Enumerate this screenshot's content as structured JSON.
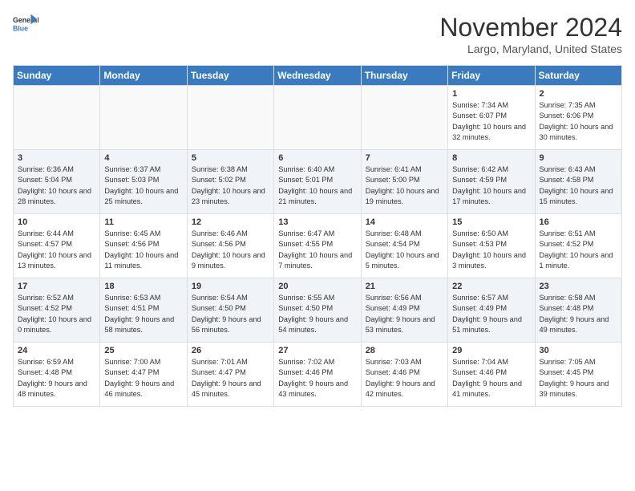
{
  "header": {
    "logo_line1": "General",
    "logo_line2": "Blue",
    "month": "November 2024",
    "location": "Largo, Maryland, United States"
  },
  "weekdays": [
    "Sunday",
    "Monday",
    "Tuesday",
    "Wednesday",
    "Thursday",
    "Friday",
    "Saturday"
  ],
  "weeks": [
    [
      {
        "day": "",
        "info": ""
      },
      {
        "day": "",
        "info": ""
      },
      {
        "day": "",
        "info": ""
      },
      {
        "day": "",
        "info": ""
      },
      {
        "day": "",
        "info": ""
      },
      {
        "day": "1",
        "info": "Sunrise: 7:34 AM\nSunset: 6:07 PM\nDaylight: 10 hours and 32 minutes."
      },
      {
        "day": "2",
        "info": "Sunrise: 7:35 AM\nSunset: 6:06 PM\nDaylight: 10 hours and 30 minutes."
      }
    ],
    [
      {
        "day": "3",
        "info": "Sunrise: 6:36 AM\nSunset: 5:04 PM\nDaylight: 10 hours and 28 minutes."
      },
      {
        "day": "4",
        "info": "Sunrise: 6:37 AM\nSunset: 5:03 PM\nDaylight: 10 hours and 25 minutes."
      },
      {
        "day": "5",
        "info": "Sunrise: 6:38 AM\nSunset: 5:02 PM\nDaylight: 10 hours and 23 minutes."
      },
      {
        "day": "6",
        "info": "Sunrise: 6:40 AM\nSunset: 5:01 PM\nDaylight: 10 hours and 21 minutes."
      },
      {
        "day": "7",
        "info": "Sunrise: 6:41 AM\nSunset: 5:00 PM\nDaylight: 10 hours and 19 minutes."
      },
      {
        "day": "8",
        "info": "Sunrise: 6:42 AM\nSunset: 4:59 PM\nDaylight: 10 hours and 17 minutes."
      },
      {
        "day": "9",
        "info": "Sunrise: 6:43 AM\nSunset: 4:58 PM\nDaylight: 10 hours and 15 minutes."
      }
    ],
    [
      {
        "day": "10",
        "info": "Sunrise: 6:44 AM\nSunset: 4:57 PM\nDaylight: 10 hours and 13 minutes."
      },
      {
        "day": "11",
        "info": "Sunrise: 6:45 AM\nSunset: 4:56 PM\nDaylight: 10 hours and 11 minutes."
      },
      {
        "day": "12",
        "info": "Sunrise: 6:46 AM\nSunset: 4:56 PM\nDaylight: 10 hours and 9 minutes."
      },
      {
        "day": "13",
        "info": "Sunrise: 6:47 AM\nSunset: 4:55 PM\nDaylight: 10 hours and 7 minutes."
      },
      {
        "day": "14",
        "info": "Sunrise: 6:48 AM\nSunset: 4:54 PM\nDaylight: 10 hours and 5 minutes."
      },
      {
        "day": "15",
        "info": "Sunrise: 6:50 AM\nSunset: 4:53 PM\nDaylight: 10 hours and 3 minutes."
      },
      {
        "day": "16",
        "info": "Sunrise: 6:51 AM\nSunset: 4:52 PM\nDaylight: 10 hours and 1 minute."
      }
    ],
    [
      {
        "day": "17",
        "info": "Sunrise: 6:52 AM\nSunset: 4:52 PM\nDaylight: 10 hours and 0 minutes."
      },
      {
        "day": "18",
        "info": "Sunrise: 6:53 AM\nSunset: 4:51 PM\nDaylight: 9 hours and 58 minutes."
      },
      {
        "day": "19",
        "info": "Sunrise: 6:54 AM\nSunset: 4:50 PM\nDaylight: 9 hours and 56 minutes."
      },
      {
        "day": "20",
        "info": "Sunrise: 6:55 AM\nSunset: 4:50 PM\nDaylight: 9 hours and 54 minutes."
      },
      {
        "day": "21",
        "info": "Sunrise: 6:56 AM\nSunset: 4:49 PM\nDaylight: 9 hours and 53 minutes."
      },
      {
        "day": "22",
        "info": "Sunrise: 6:57 AM\nSunset: 4:49 PM\nDaylight: 9 hours and 51 minutes."
      },
      {
        "day": "23",
        "info": "Sunrise: 6:58 AM\nSunset: 4:48 PM\nDaylight: 9 hours and 49 minutes."
      }
    ],
    [
      {
        "day": "24",
        "info": "Sunrise: 6:59 AM\nSunset: 4:48 PM\nDaylight: 9 hours and 48 minutes."
      },
      {
        "day": "25",
        "info": "Sunrise: 7:00 AM\nSunset: 4:47 PM\nDaylight: 9 hours and 46 minutes."
      },
      {
        "day": "26",
        "info": "Sunrise: 7:01 AM\nSunset: 4:47 PM\nDaylight: 9 hours and 45 minutes."
      },
      {
        "day": "27",
        "info": "Sunrise: 7:02 AM\nSunset: 4:46 PM\nDaylight: 9 hours and 43 minutes."
      },
      {
        "day": "28",
        "info": "Sunrise: 7:03 AM\nSunset: 4:46 PM\nDaylight: 9 hours and 42 minutes."
      },
      {
        "day": "29",
        "info": "Sunrise: 7:04 AM\nSunset: 4:46 PM\nDaylight: 9 hours and 41 minutes."
      },
      {
        "day": "30",
        "info": "Sunrise: 7:05 AM\nSunset: 4:45 PM\nDaylight: 9 hours and 39 minutes."
      }
    ]
  ]
}
